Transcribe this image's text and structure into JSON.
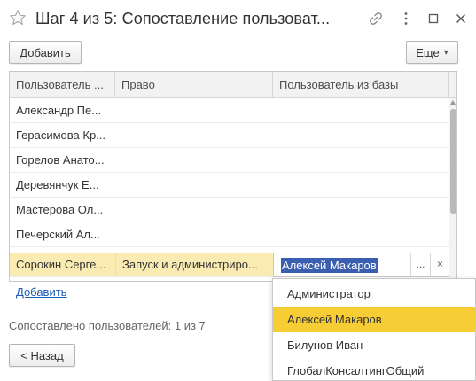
{
  "window": {
    "title": "Шаг 4 из 5: Сопоставление пользоват...",
    "icons": [
      "star-icon",
      "link-icon",
      "more-icon",
      "maximize-icon",
      "close-icon"
    ]
  },
  "toolbar": {
    "add_label": "Добавить",
    "more_label": "Еще",
    "more_arrow": "▾"
  },
  "table": {
    "columns": [
      "Пользователь ...",
      "Право",
      "Пользователь из базы"
    ],
    "rows": [
      {
        "user": "Александр Пе...",
        "right": "",
        "db_user": ""
      },
      {
        "user": "Герасимова Кр...",
        "right": "",
        "db_user": ""
      },
      {
        "user": "Горелов Анато...",
        "right": "",
        "db_user": ""
      },
      {
        "user": "Деревянчук Е...",
        "right": "",
        "db_user": ""
      },
      {
        "user": "Мастерова Ол...",
        "right": "",
        "db_user": ""
      },
      {
        "user": "Печерский Ал...",
        "right": "",
        "db_user": ""
      },
      {
        "user": "Сорокин Серге...",
        "right": "Запуск и администриро...",
        "db_user": "Алексей Макаров",
        "selected": true
      }
    ],
    "editor": {
      "value": "Алексей Макаров",
      "choose_label": "...",
      "clear_label": "×"
    },
    "add_link": "Добавить"
  },
  "dropdown": {
    "items": [
      "Администратор",
      "Алексей Макаров",
      "Билунов Иван",
      "ГлобалКонсалтингОбщий"
    ],
    "selected_index": 1
  },
  "status": "Сопоставлено пользователей: 1 из 7",
  "footer": {
    "back_label": "< Назад"
  },
  "colors": {
    "selection_row": "#fbf0c8",
    "highlight": "#f7cd35",
    "text_selection": "#3a5fb0",
    "link": "#1a5db6"
  }
}
